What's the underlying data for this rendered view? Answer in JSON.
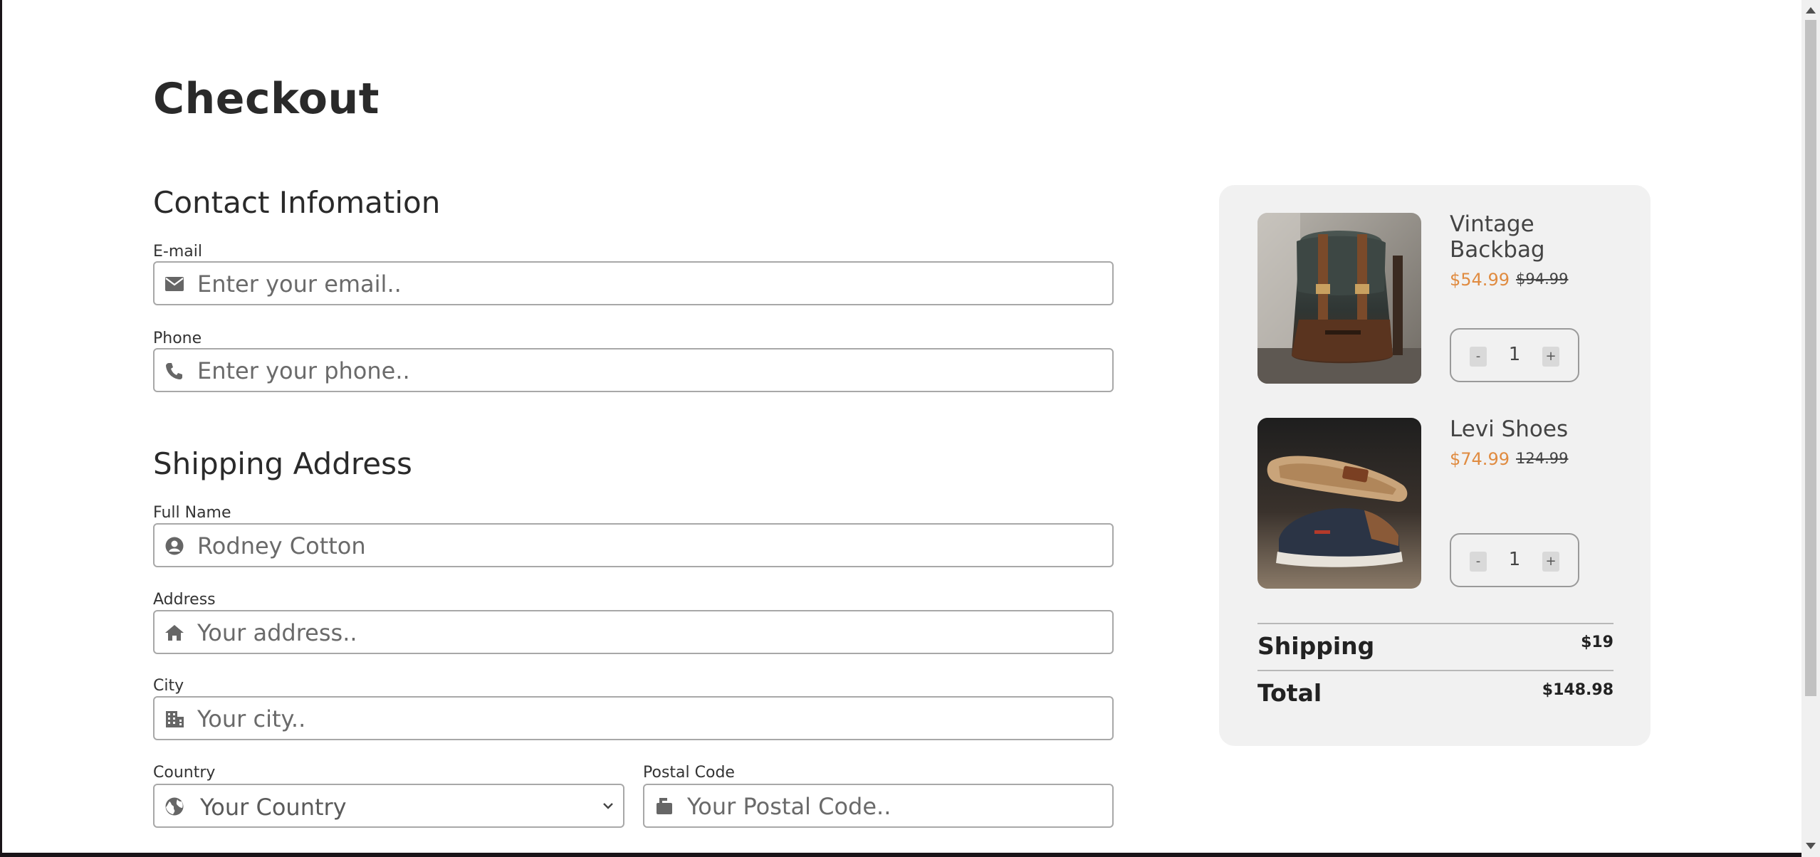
{
  "page": {
    "title": "Checkout"
  },
  "contact": {
    "heading": "Contact Infomation",
    "email": {
      "label": "E-mail",
      "placeholder": "Enter your email..",
      "icon": "envelope-icon"
    },
    "phone": {
      "label": "Phone",
      "placeholder": "Enter your phone..",
      "icon": "phone-icon"
    }
  },
  "shipping": {
    "heading": "Shipping Address",
    "full_name": {
      "label": "Full Name",
      "placeholder": "Rodney Cotton",
      "icon": "user-circle-icon"
    },
    "address": {
      "label": "Address",
      "placeholder": "Your address..",
      "icon": "home-icon"
    },
    "city": {
      "label": "City",
      "placeholder": "Your city..",
      "icon": "building-icon"
    },
    "country": {
      "label": "Country",
      "selected": "Your Country",
      "icon": "globe-icon"
    },
    "postal": {
      "label": "Postal Code",
      "placeholder": "Your Postal Code..",
      "icon": "mailbox-icon"
    }
  },
  "cart": {
    "items": [
      {
        "name": "Vintage Backbag",
        "price": "$54.99",
        "old_price": "$94.99",
        "qty": "1",
        "minus": "-",
        "plus": "+"
      },
      {
        "name": "Levi Shoes",
        "price": "$74.99",
        "old_price": "124.99",
        "qty": "1",
        "minus": "-",
        "plus": "+"
      }
    ],
    "shipping_label": "Shipping",
    "shipping_value": "$19",
    "total_label": "Total",
    "total_value": "$148.98"
  },
  "colors": {
    "accent_price": "#e08b40",
    "summary_bg": "#f1f1f1",
    "border": "#a8a8a8"
  }
}
